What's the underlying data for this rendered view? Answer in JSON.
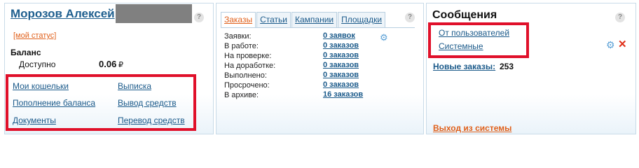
{
  "user": {
    "name": "Морозов Алексей",
    "status_link": "[мой статус]",
    "balance_label": "Баланс",
    "available_label": "Доступно",
    "available_value": "0.06",
    "currency": "₽",
    "links": {
      "wallets": "Мои кошельки",
      "statement": "Выписка",
      "topup": "Пополнение баланса",
      "withdraw": "Вывод средств",
      "documents": "Документы",
      "transfer": "Перевод средств"
    },
    "help": "?"
  },
  "orders": {
    "tabs": [
      "Заказы",
      "Статьи",
      "Кампании",
      "Площадки"
    ],
    "active_tab": "Заказы",
    "rows": [
      {
        "label": "Заявки:",
        "value": "0 заявок"
      },
      {
        "label": "В работе:",
        "value": "0 заказов"
      },
      {
        "label": "На проверке:",
        "value": "0 заказов"
      },
      {
        "label": "На доработке:",
        "value": "0 заказов"
      },
      {
        "label": "Выполнено:",
        "value": "0 заказов"
      },
      {
        "label": "Просрочено:",
        "value": "0 заказов"
      },
      {
        "label": "В архиве:",
        "value": "16 заказов"
      }
    ],
    "help": "?"
  },
  "messages": {
    "title": "Сообщения",
    "from_users": "От пользователей",
    "system": "Системные",
    "new_orders_label": "Новые заказы:",
    "new_orders_count": "253",
    "logout": "Выход из системы",
    "help": "?"
  },
  "colors": {
    "link": "#1b5a8a",
    "accent_orange": "#e0601b",
    "highlight_red": "#e0102a",
    "panel_border": "#c9dbe8"
  }
}
